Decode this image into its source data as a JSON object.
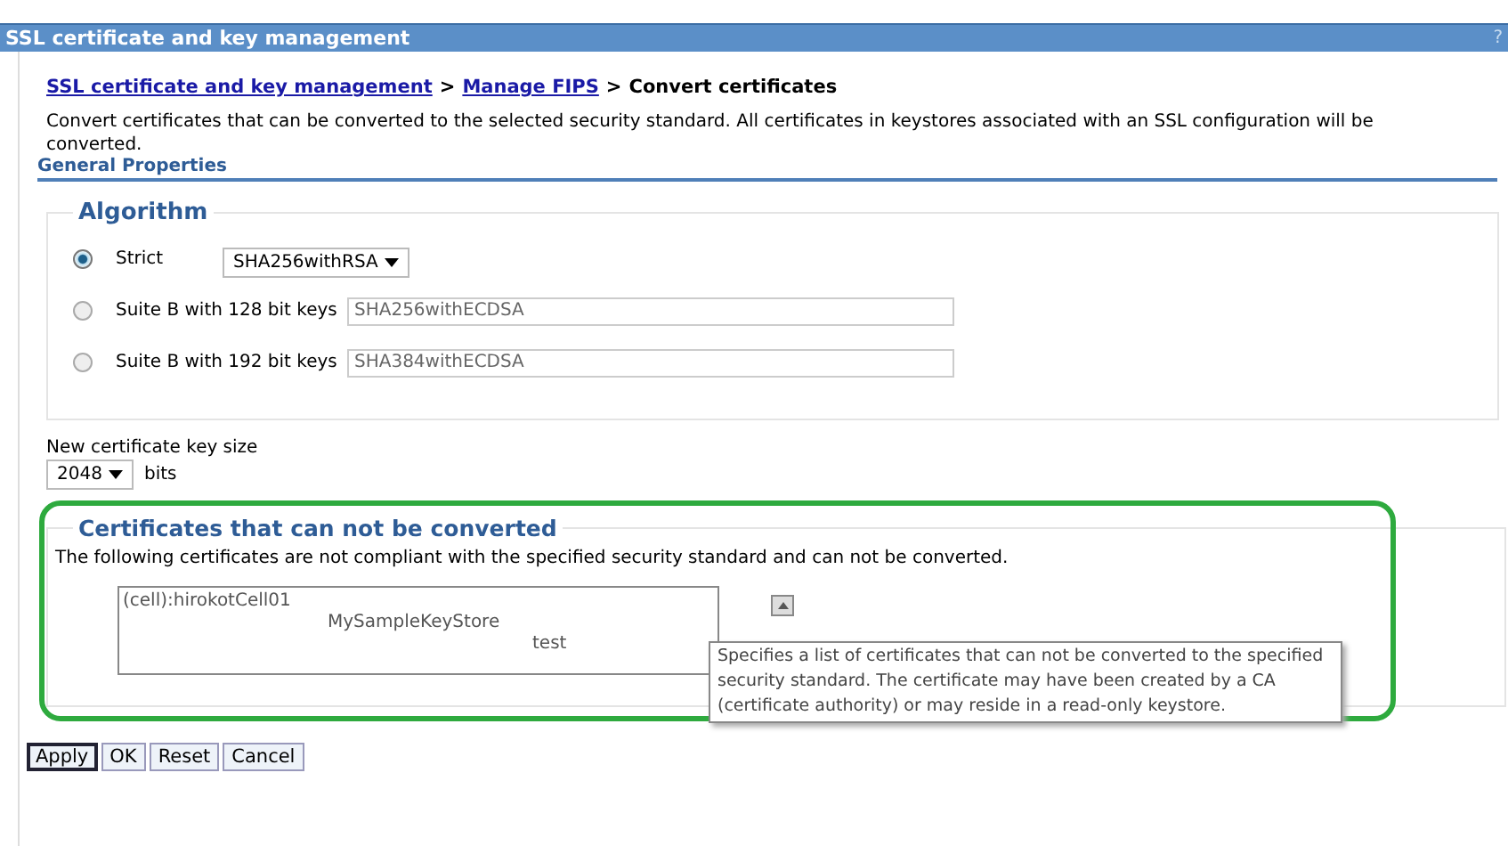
{
  "window": {
    "title": "SSL certificate and key management",
    "help": "?"
  },
  "breadcrumb": [
    {
      "label": "SSL certificate and key management",
      "kind": "link"
    },
    {
      "label": "Manage FIPS",
      "kind": "link"
    },
    {
      "label": "Convert certificates",
      "kind": "current"
    }
  ],
  "breadcrumb_separator": ">",
  "description": "Convert certificates that can be converted to the selected security standard. All certificates in keystores associated with an SSL configuration will be converted.",
  "section_title": "General Properties",
  "algorithm": {
    "legend": "Algorithm",
    "options": [
      {
        "label": "Strict",
        "selected": true,
        "kind": "select",
        "value": "SHA256withRSA"
      },
      {
        "label": "Suite B with 128 bit keys",
        "selected": false,
        "kind": "text",
        "value": "SHA256withECDSA"
      },
      {
        "label": "Suite B with 192 bit keys",
        "selected": false,
        "kind": "text",
        "value": "SHA384withECDSA"
      }
    ]
  },
  "key_size": {
    "label": "New certificate key size",
    "value": "2048",
    "unit": "bits"
  },
  "not_converted": {
    "legend": "Certificates that can not be converted",
    "description": "The following certificates are not compliant with the specified security standard and can not be converted.",
    "items": [
      {
        "label": "(cell):hirokotCell01",
        "children": [
          {
            "label": "MySampleKeyStore",
            "children": [
              {
                "label": "test"
              }
            ]
          }
        ]
      }
    ],
    "tooltip": "Specifies a list of certificates that can not be converted to the specified security standard. The certificate may have been created by a CA (certificate authority) or may reside in a read-only keystore."
  },
  "buttons": [
    {
      "label": "Apply",
      "selected": true
    },
    {
      "label": "OK",
      "selected": false
    },
    {
      "label": "Reset",
      "selected": false
    },
    {
      "label": "Cancel",
      "selected": false
    }
  ]
}
